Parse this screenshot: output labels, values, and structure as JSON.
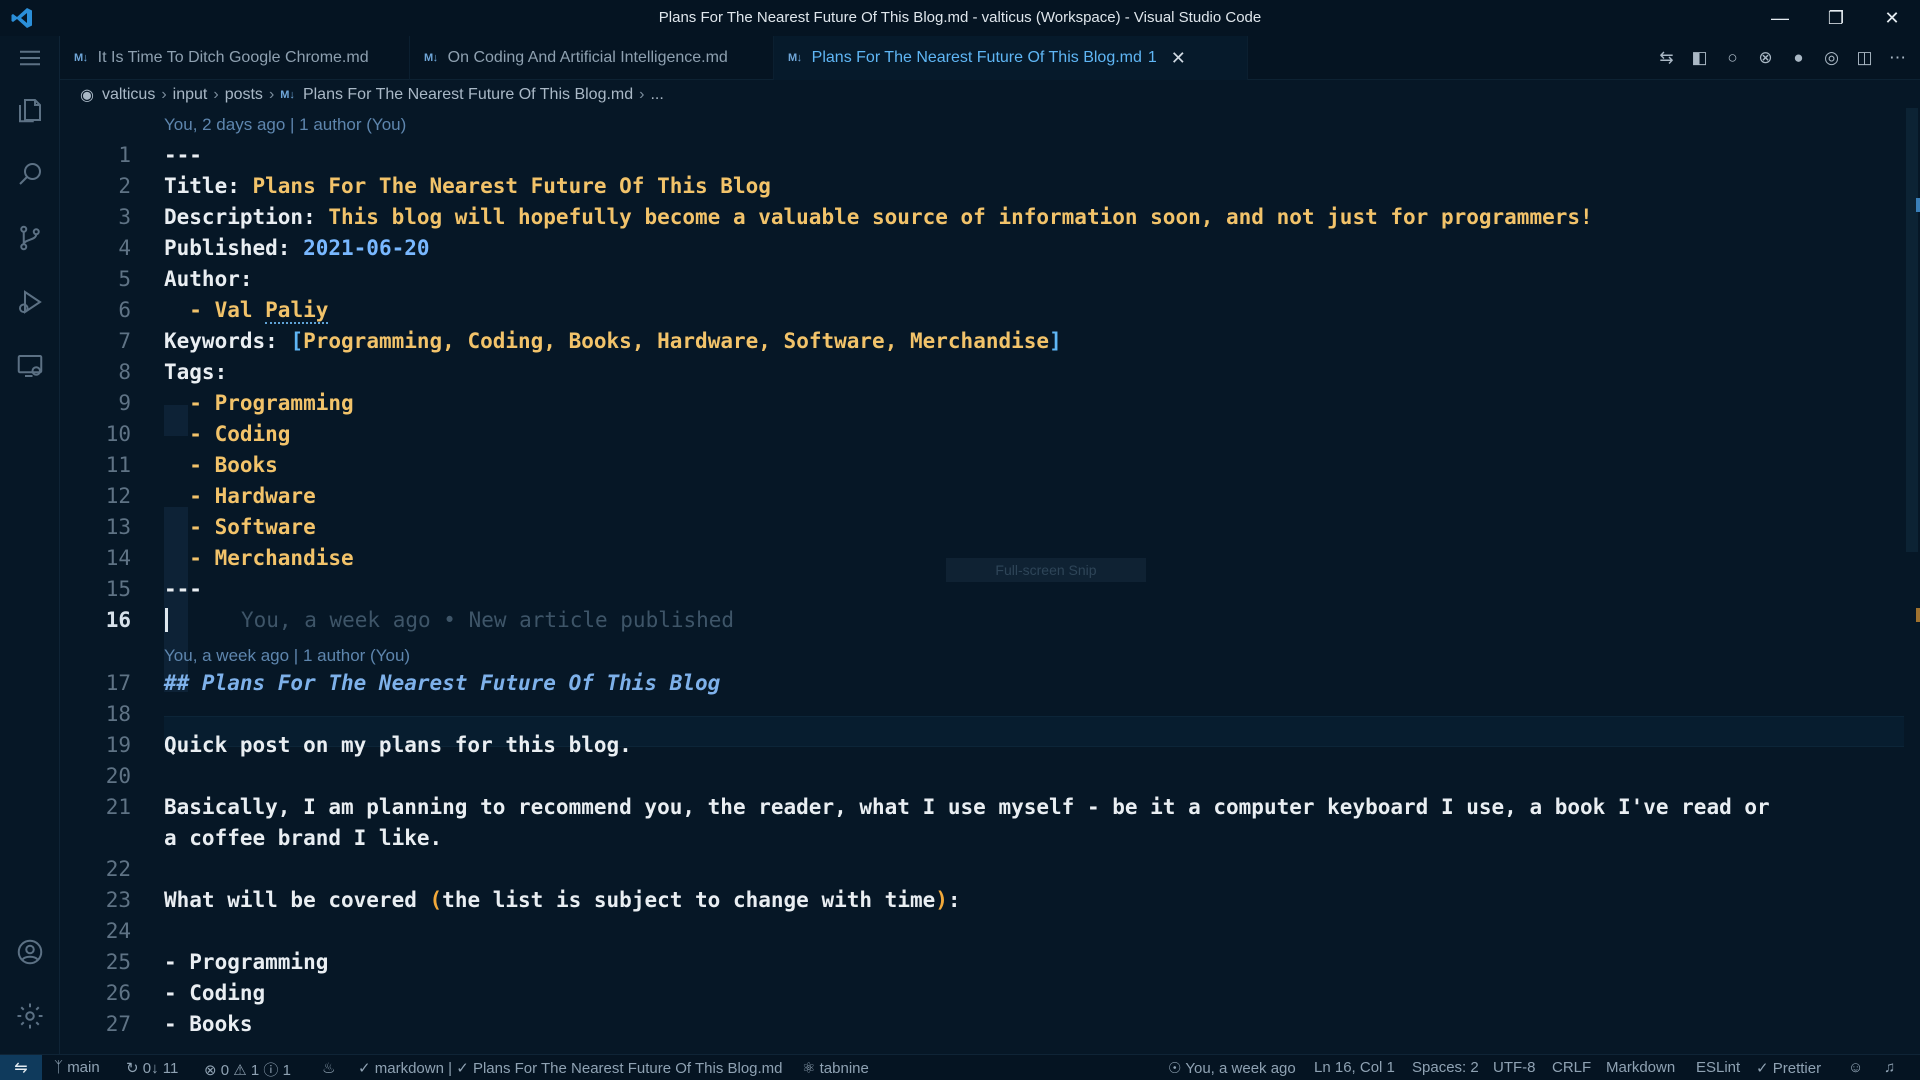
{
  "window": {
    "title": "Plans For The Nearest Future Of This Blog.md - valticus (Workspace) - Visual Studio Code",
    "controls": [
      "minimize",
      "restore",
      "close"
    ]
  },
  "tabs": [
    {
      "icon": "M↓",
      "label": "It Is Time To Ditch Google Chrome.md",
      "active": false
    },
    {
      "icon": "M↓",
      "label": "On Coding And Artificial Intelligence.md",
      "active": false
    },
    {
      "icon": "M↓",
      "label": "Plans For The Nearest Future Of This Blog.md",
      "badge": "1",
      "active": true
    }
  ],
  "breadcrumb": {
    "items": [
      "valticus",
      "input",
      "posts"
    ],
    "file_icon": "M↓",
    "file": "Plans For The Nearest Future Of This Blog.md",
    "more": "..."
  },
  "editor": {
    "codelens_top": "You, 2 days ago | 1 author (You)",
    "codelens_mid": "You, a week ago | 1 author (You)",
    "inline_blame": "You, a week ago • New article published",
    "overlay_label": "Full-screen Snip",
    "lines": [
      {
        "n": "1",
        "text": "---"
      },
      {
        "n": "2",
        "key": "Title:",
        "val": " Plans For The Nearest Future Of This Blog"
      },
      {
        "n": "3",
        "key": "Description:",
        "val": " This blog will hopefully become a valuable source of information soon, and not just for programmers!"
      },
      {
        "n": "4",
        "key": "Published:",
        "val": " 2021-06-20"
      },
      {
        "n": "5",
        "key": "Author:",
        "val": ""
      },
      {
        "n": "6",
        "text": "  - Val ",
        "word": "Paliy"
      },
      {
        "n": "7",
        "key": "Keywords:",
        "open": "[",
        "list": "Programming, Coding, Books, Hardware, Software, Merchandise",
        "close": "]"
      },
      {
        "n": "8",
        "key": "Tags:",
        "val": ""
      },
      {
        "n": "9",
        "text": "  - Programming"
      },
      {
        "n": "10",
        "text": "  - Coding"
      },
      {
        "n": "11",
        "text": "  - Books"
      },
      {
        "n": "12",
        "text": "  - Hardware"
      },
      {
        "n": "13",
        "text": "  - Software"
      },
      {
        "n": "14",
        "text": "  - Merchandise"
      },
      {
        "n": "15",
        "text": "---"
      },
      {
        "n": "16",
        "text": ""
      },
      {
        "n": "17",
        "heading": "## Plans For The Nearest Future Of This Blog"
      },
      {
        "n": "18",
        "text": ""
      },
      {
        "n": "19",
        "text": "Quick post on my plans for this blog."
      },
      {
        "n": "20",
        "text": ""
      },
      {
        "n": "21",
        "text": "Basically, I am planning to recommend you, the reader, what I use myself - be it a computer keyboard I use, a book I've read or",
        "wrap": "a coffee brand I like."
      },
      {
        "n": "22",
        "text": ""
      },
      {
        "n": "23",
        "pre": "What will be covered ",
        "paren_open": "(",
        "inner": "the list is subject to change with time",
        "paren_close": ")",
        "post": ":"
      },
      {
        "n": "24",
        "text": ""
      },
      {
        "n": "25",
        "text": "- Programming"
      },
      {
        "n": "26",
        "text": "- Coding"
      },
      {
        "n": "27",
        "text": "- Books"
      }
    ]
  },
  "statusbar": {
    "branch": "main",
    "sync": "0↓ 11",
    "errors": "0",
    "warnings": "1",
    "info": "1",
    "lang_check": "markdown |",
    "file_check": "Plans For The Nearest Future Of This Blog.md",
    "tabnine": "tabnine",
    "blame": "You, a week ago",
    "position": "Ln 16, Col 1",
    "spaces": "Spaces: 2",
    "encoding": "UTF-8",
    "eol": "CRLF",
    "language": "Markdown",
    "eslint": "ESLint",
    "prettier": "Prettier"
  },
  "colors": {
    "background": "#061726",
    "accent": "#5fb6f5",
    "yaml_value": "#f2c36a",
    "heading": "#7eb1ea"
  }
}
